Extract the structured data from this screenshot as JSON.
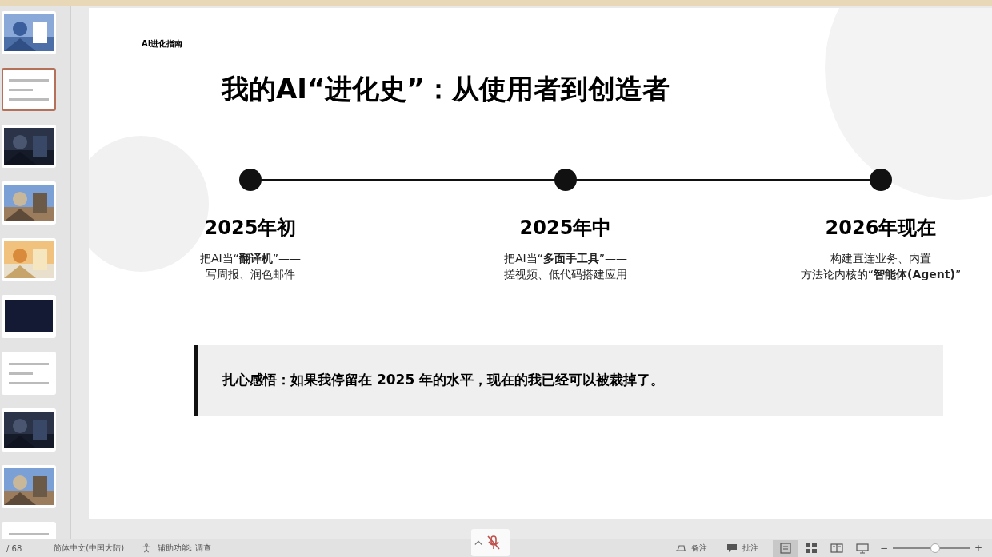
{
  "thumbnails": [
    {
      "kind": "picture",
      "selected": false
    },
    {
      "kind": "slide",
      "selected": true
    },
    {
      "kind": "picture",
      "selected": false
    },
    {
      "kind": "picture",
      "selected": false
    },
    {
      "kind": "picture",
      "selected": false
    },
    {
      "kind": "dark",
      "selected": false
    },
    {
      "kind": "slide",
      "selected": false
    },
    {
      "kind": "picture",
      "selected": false
    },
    {
      "kind": "picture",
      "selected": false
    },
    {
      "kind": "slide",
      "selected": false
    }
  ],
  "slide": {
    "header": "AI进化指南",
    "title": "我的AI“进化史”：从使用者到创造者",
    "milestones": [
      {
        "year": "2025年初",
        "lines": [
          "把AI当“**翻译机**”——",
          "写周报、润色邮件"
        ]
      },
      {
        "year": "2025年中",
        "lines": [
          "把AI当“**多面手工具**”——",
          "搓视频、低代码搭建应用"
        ]
      },
      {
        "year": "2026年现在",
        "lines": [
          "构建直连业务、内置",
          "方法论内核的“**智能体(Agent)**”"
        ]
      }
    ],
    "quote": "扎心感悟：如果我停留在 2025 年的水平，现在的我已经可以被裁掉了。"
  },
  "status_bar": {
    "slide_counter": "/ 68",
    "language": "简体中文(中国大陆)",
    "accessibility": "辅助功能: 调查",
    "notes": "备注",
    "comments": "批注",
    "views": [
      {
        "kind": "normal",
        "selected": true
      },
      {
        "kind": "sorter",
        "selected": false
      },
      {
        "kind": "reading",
        "selected": false
      },
      {
        "kind": "show",
        "selected": false
      }
    ],
    "zoom": {
      "minus": "−",
      "plus": "+",
      "level": 0.55
    }
  }
}
